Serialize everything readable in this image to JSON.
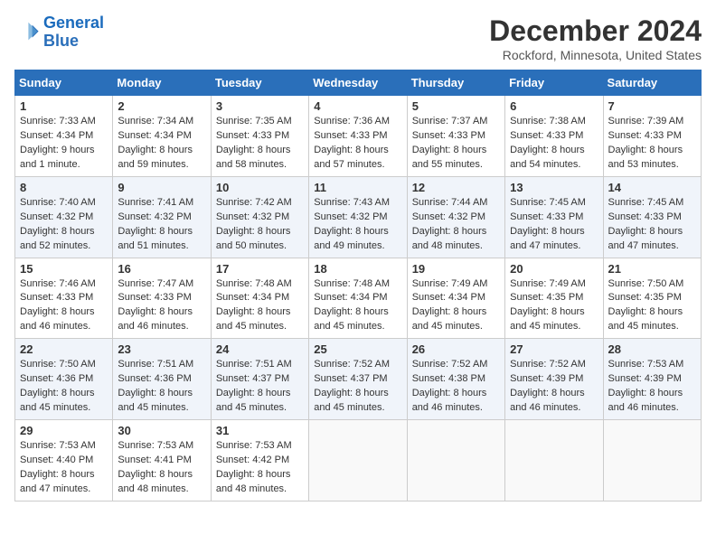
{
  "header": {
    "logo_line1": "General",
    "logo_line2": "Blue",
    "month_title": "December 2024",
    "location": "Rockford, Minnesota, United States"
  },
  "weekdays": [
    "Sunday",
    "Monday",
    "Tuesday",
    "Wednesday",
    "Thursday",
    "Friday",
    "Saturday"
  ],
  "weeks": [
    [
      {
        "day": "1",
        "sunrise": "7:33 AM",
        "sunset": "4:34 PM",
        "daylight": "9 hours and 1 minute."
      },
      {
        "day": "2",
        "sunrise": "7:34 AM",
        "sunset": "4:34 PM",
        "daylight": "8 hours and 59 minutes."
      },
      {
        "day": "3",
        "sunrise": "7:35 AM",
        "sunset": "4:33 PM",
        "daylight": "8 hours and 58 minutes."
      },
      {
        "day": "4",
        "sunrise": "7:36 AM",
        "sunset": "4:33 PM",
        "daylight": "8 hours and 57 minutes."
      },
      {
        "day": "5",
        "sunrise": "7:37 AM",
        "sunset": "4:33 PM",
        "daylight": "8 hours and 55 minutes."
      },
      {
        "day": "6",
        "sunrise": "7:38 AM",
        "sunset": "4:33 PM",
        "daylight": "8 hours and 54 minutes."
      },
      {
        "day": "7",
        "sunrise": "7:39 AM",
        "sunset": "4:33 PM",
        "daylight": "8 hours and 53 minutes."
      }
    ],
    [
      {
        "day": "8",
        "sunrise": "7:40 AM",
        "sunset": "4:32 PM",
        "daylight": "8 hours and 52 minutes."
      },
      {
        "day": "9",
        "sunrise": "7:41 AM",
        "sunset": "4:32 PM",
        "daylight": "8 hours and 51 minutes."
      },
      {
        "day": "10",
        "sunrise": "7:42 AM",
        "sunset": "4:32 PM",
        "daylight": "8 hours and 50 minutes."
      },
      {
        "day": "11",
        "sunrise": "7:43 AM",
        "sunset": "4:32 PM",
        "daylight": "8 hours and 49 minutes."
      },
      {
        "day": "12",
        "sunrise": "7:44 AM",
        "sunset": "4:32 PM",
        "daylight": "8 hours and 48 minutes."
      },
      {
        "day": "13",
        "sunrise": "7:45 AM",
        "sunset": "4:33 PM",
        "daylight": "8 hours and 47 minutes."
      },
      {
        "day": "14",
        "sunrise": "7:45 AM",
        "sunset": "4:33 PM",
        "daylight": "8 hours and 47 minutes."
      }
    ],
    [
      {
        "day": "15",
        "sunrise": "7:46 AM",
        "sunset": "4:33 PM",
        "daylight": "8 hours and 46 minutes."
      },
      {
        "day": "16",
        "sunrise": "7:47 AM",
        "sunset": "4:33 PM",
        "daylight": "8 hours and 46 minutes."
      },
      {
        "day": "17",
        "sunrise": "7:48 AM",
        "sunset": "4:34 PM",
        "daylight": "8 hours and 45 minutes."
      },
      {
        "day": "18",
        "sunrise": "7:48 AM",
        "sunset": "4:34 PM",
        "daylight": "8 hours and 45 minutes."
      },
      {
        "day": "19",
        "sunrise": "7:49 AM",
        "sunset": "4:34 PM",
        "daylight": "8 hours and 45 minutes."
      },
      {
        "day": "20",
        "sunrise": "7:49 AM",
        "sunset": "4:35 PM",
        "daylight": "8 hours and 45 minutes."
      },
      {
        "day": "21",
        "sunrise": "7:50 AM",
        "sunset": "4:35 PM",
        "daylight": "8 hours and 45 minutes."
      }
    ],
    [
      {
        "day": "22",
        "sunrise": "7:50 AM",
        "sunset": "4:36 PM",
        "daylight": "8 hours and 45 minutes."
      },
      {
        "day": "23",
        "sunrise": "7:51 AM",
        "sunset": "4:36 PM",
        "daylight": "8 hours and 45 minutes."
      },
      {
        "day": "24",
        "sunrise": "7:51 AM",
        "sunset": "4:37 PM",
        "daylight": "8 hours and 45 minutes."
      },
      {
        "day": "25",
        "sunrise": "7:52 AM",
        "sunset": "4:37 PM",
        "daylight": "8 hours and 45 minutes."
      },
      {
        "day": "26",
        "sunrise": "7:52 AM",
        "sunset": "4:38 PM",
        "daylight": "8 hours and 46 minutes."
      },
      {
        "day": "27",
        "sunrise": "7:52 AM",
        "sunset": "4:39 PM",
        "daylight": "8 hours and 46 minutes."
      },
      {
        "day": "28",
        "sunrise": "7:53 AM",
        "sunset": "4:39 PM",
        "daylight": "8 hours and 46 minutes."
      }
    ],
    [
      {
        "day": "29",
        "sunrise": "7:53 AM",
        "sunset": "4:40 PM",
        "daylight": "8 hours and 47 minutes."
      },
      {
        "day": "30",
        "sunrise": "7:53 AM",
        "sunset": "4:41 PM",
        "daylight": "8 hours and 48 minutes."
      },
      {
        "day": "31",
        "sunrise": "7:53 AM",
        "sunset": "4:42 PM",
        "daylight": "8 hours and 48 minutes."
      },
      null,
      null,
      null,
      null
    ]
  ],
  "labels": {
    "sunrise": "Sunrise:",
    "sunset": "Sunset:",
    "daylight": "Daylight:"
  }
}
